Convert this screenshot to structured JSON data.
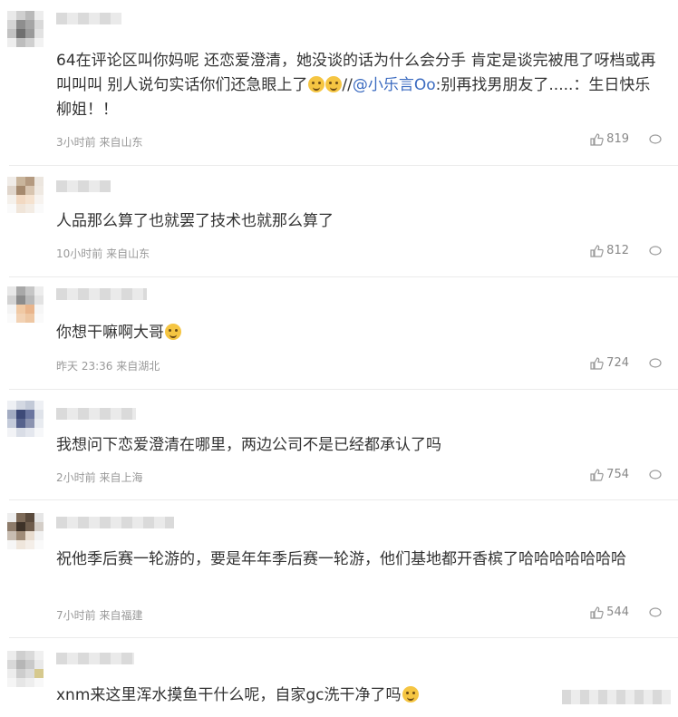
{
  "comments": [
    {
      "text_before": "64在评论区叫你妈呢 还恋爱澄清，她没谈的话为什么会分手 肯定是谈完被甩了呀档或再叫叫叫 别人说句实话你们还急眼上了",
      "text_mid": "//",
      "mention": "@小乐言Oo",
      "text_after": ":别再找男朋友了.....：生日快乐柳姐！！",
      "time": "3小时前 来自山东",
      "likes": "819"
    },
    {
      "text": "人品那么算了也就罢了技术也就那么算了",
      "time": "10小时前 来自山东",
      "likes": "812"
    },
    {
      "text": "你想干嘛啊大哥",
      "time": "昨天 23:36 来自湖北",
      "likes": "724"
    },
    {
      "text": "我想问下恋爱澄清在哪里，两边公司不是已经都承认了吗",
      "time": "2小时前 来自上海",
      "likes": "754"
    },
    {
      "text": "祝他季后赛一轮游的，要是年年季后赛一轮游，他们基地都开香槟了哈哈哈哈哈哈哈",
      "time": "7小时前 来自福建",
      "likes": "544"
    },
    {
      "text": "xnm来这里浑水摸鱼干什么呢，自家gc洗干净了吗"
    }
  ],
  "icons": {
    "like": "thumbs-up-icon",
    "reply": "comment-bubble-icon",
    "emoji": "emoji-icon"
  },
  "colors": {
    "mention": "#3b6bc0",
    "meta": "#999999",
    "divider": "#ebebeb"
  }
}
